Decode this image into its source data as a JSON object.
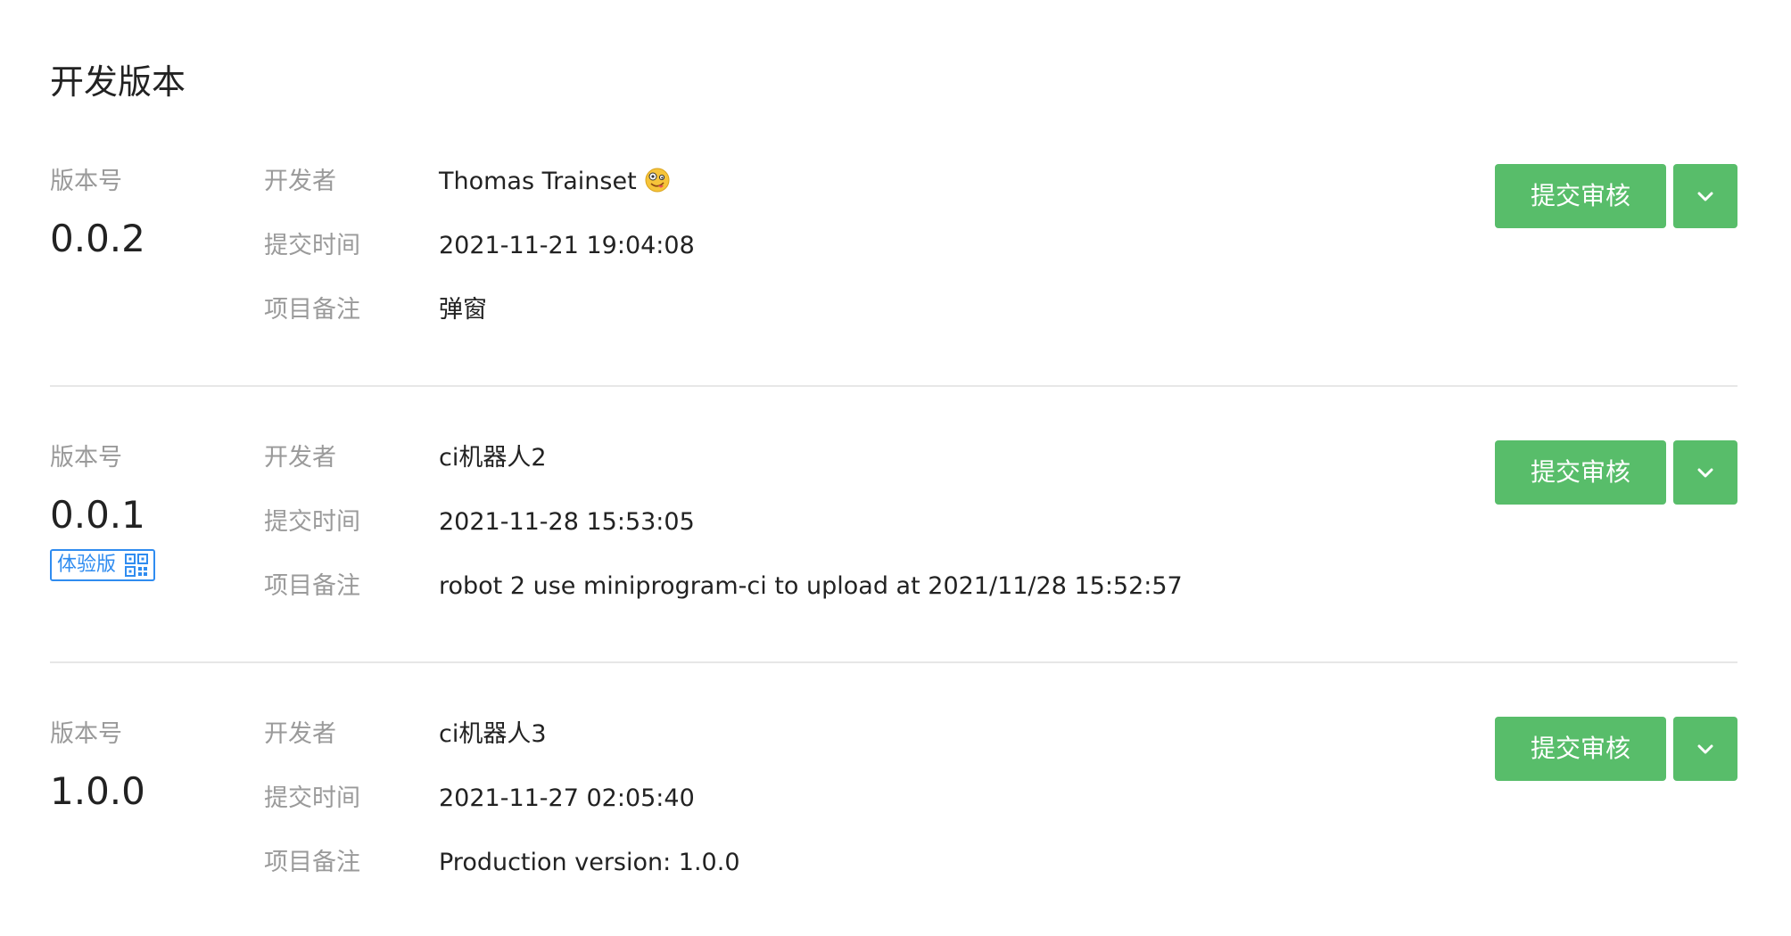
{
  "page": {
    "title": "开发版本"
  },
  "labels": {
    "version": "版本号",
    "developer": "开发者",
    "submit_time": "提交时间",
    "note": "项目备注",
    "submit_button": "提交审核",
    "trial_badge": "体验版"
  },
  "versions": [
    {
      "version": "0.0.2",
      "developer": "Thomas Trainset",
      "developer_emoji": "zany-face-icon",
      "submit_time": "2021-11-21 19:04:08",
      "note": "弹窗",
      "is_trial": false
    },
    {
      "version": "0.0.1",
      "developer": "ci机器人2",
      "submit_time": "2021-11-28 15:53:05",
      "note": "robot 2 use miniprogram-ci to upload at 2021/11/28 15:52:57",
      "is_trial": true
    },
    {
      "version": "1.0.0",
      "developer": "ci机器人3",
      "submit_time": "2021-11-27 02:05:40",
      "note": "Production version: 1.0.0",
      "is_trial": false
    }
  ],
  "colors": {
    "primary_button": "#58bd6a",
    "trial_badge": "#2f8cf0",
    "label_gray": "#9a9a9a",
    "divider": "#e7e7e7"
  }
}
